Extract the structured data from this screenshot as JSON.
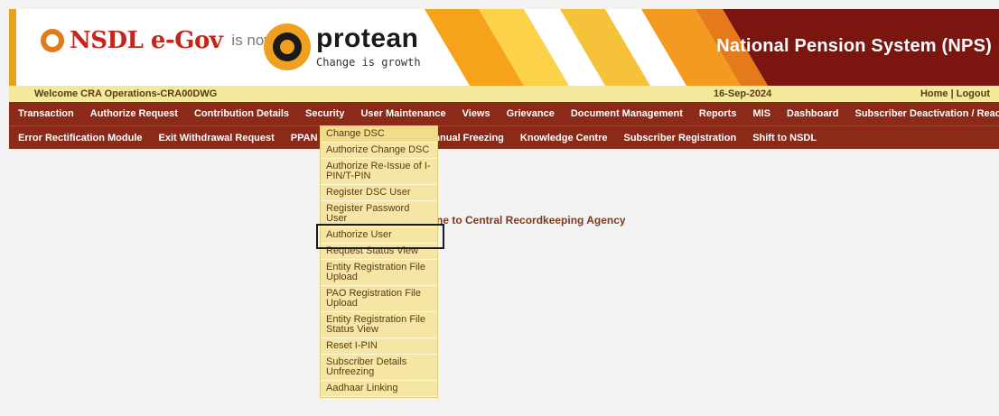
{
  "header": {
    "nsdl_logo": "NSDL e-Gov",
    "is_now": "is now",
    "protean_name": "protean",
    "protean_tagline": "Change is growth",
    "system_title": "National Pension System (NPS)"
  },
  "welcome_bar": {
    "welcome_text": "Welcome CRA Operations-CRA00DWG",
    "date": "16-Sep-2024",
    "home": "Home",
    "separator": "|",
    "logout": "Logout"
  },
  "nav_primary": [
    {
      "label": "Transaction"
    },
    {
      "label": "Authorize Request"
    },
    {
      "label": "Contribution Details"
    },
    {
      "label": "Security"
    },
    {
      "label": "User Maintenance"
    },
    {
      "label": "Views"
    },
    {
      "label": "Grievance"
    },
    {
      "label": "Document Management"
    },
    {
      "label": "Reports"
    },
    {
      "label": "MIS"
    },
    {
      "label": "Dashboard"
    },
    {
      "label": "Subscriber Deactivation / Reactivation"
    }
  ],
  "nav_secondary": [
    {
      "label": "Error Rectification Module"
    },
    {
      "label": "Exit Withdrawal Request"
    },
    {
      "label": "PPAN Name F"
    },
    {
      "label": "Annual Freezing"
    },
    {
      "label": "Knowledge Centre"
    },
    {
      "label": "Subscriber Registration"
    },
    {
      "label": "Shift to NSDL"
    }
  ],
  "main": {
    "welcome_message": "ne to Central Recordkeeping Agency"
  },
  "user_maintenance_menu": [
    {
      "label": "Change DSC"
    },
    {
      "label": "Authorize Change DSC"
    },
    {
      "label": "Authorize Re-Issue of I-PIN/T-PIN"
    },
    {
      "label": "Register DSC User"
    },
    {
      "label": "Register Password User"
    },
    {
      "label": "Authorize User"
    },
    {
      "label": "Request Status View"
    },
    {
      "label": "Entity Registration File Upload"
    },
    {
      "label": "PAO Registration File Upload"
    },
    {
      "label": "Entity Registration File Status View"
    },
    {
      "label": "Reset I-PIN"
    },
    {
      "label": "Subscriber Details Unfreezing"
    },
    {
      "label": "Aadhaar Linking"
    }
  ],
  "colors": {
    "nav_bg": "#8b2a18",
    "welcome_bar_bg": "#f3e99a",
    "dropdown_bg": "#f5e6a6",
    "banner_dark": "#7a1510"
  }
}
